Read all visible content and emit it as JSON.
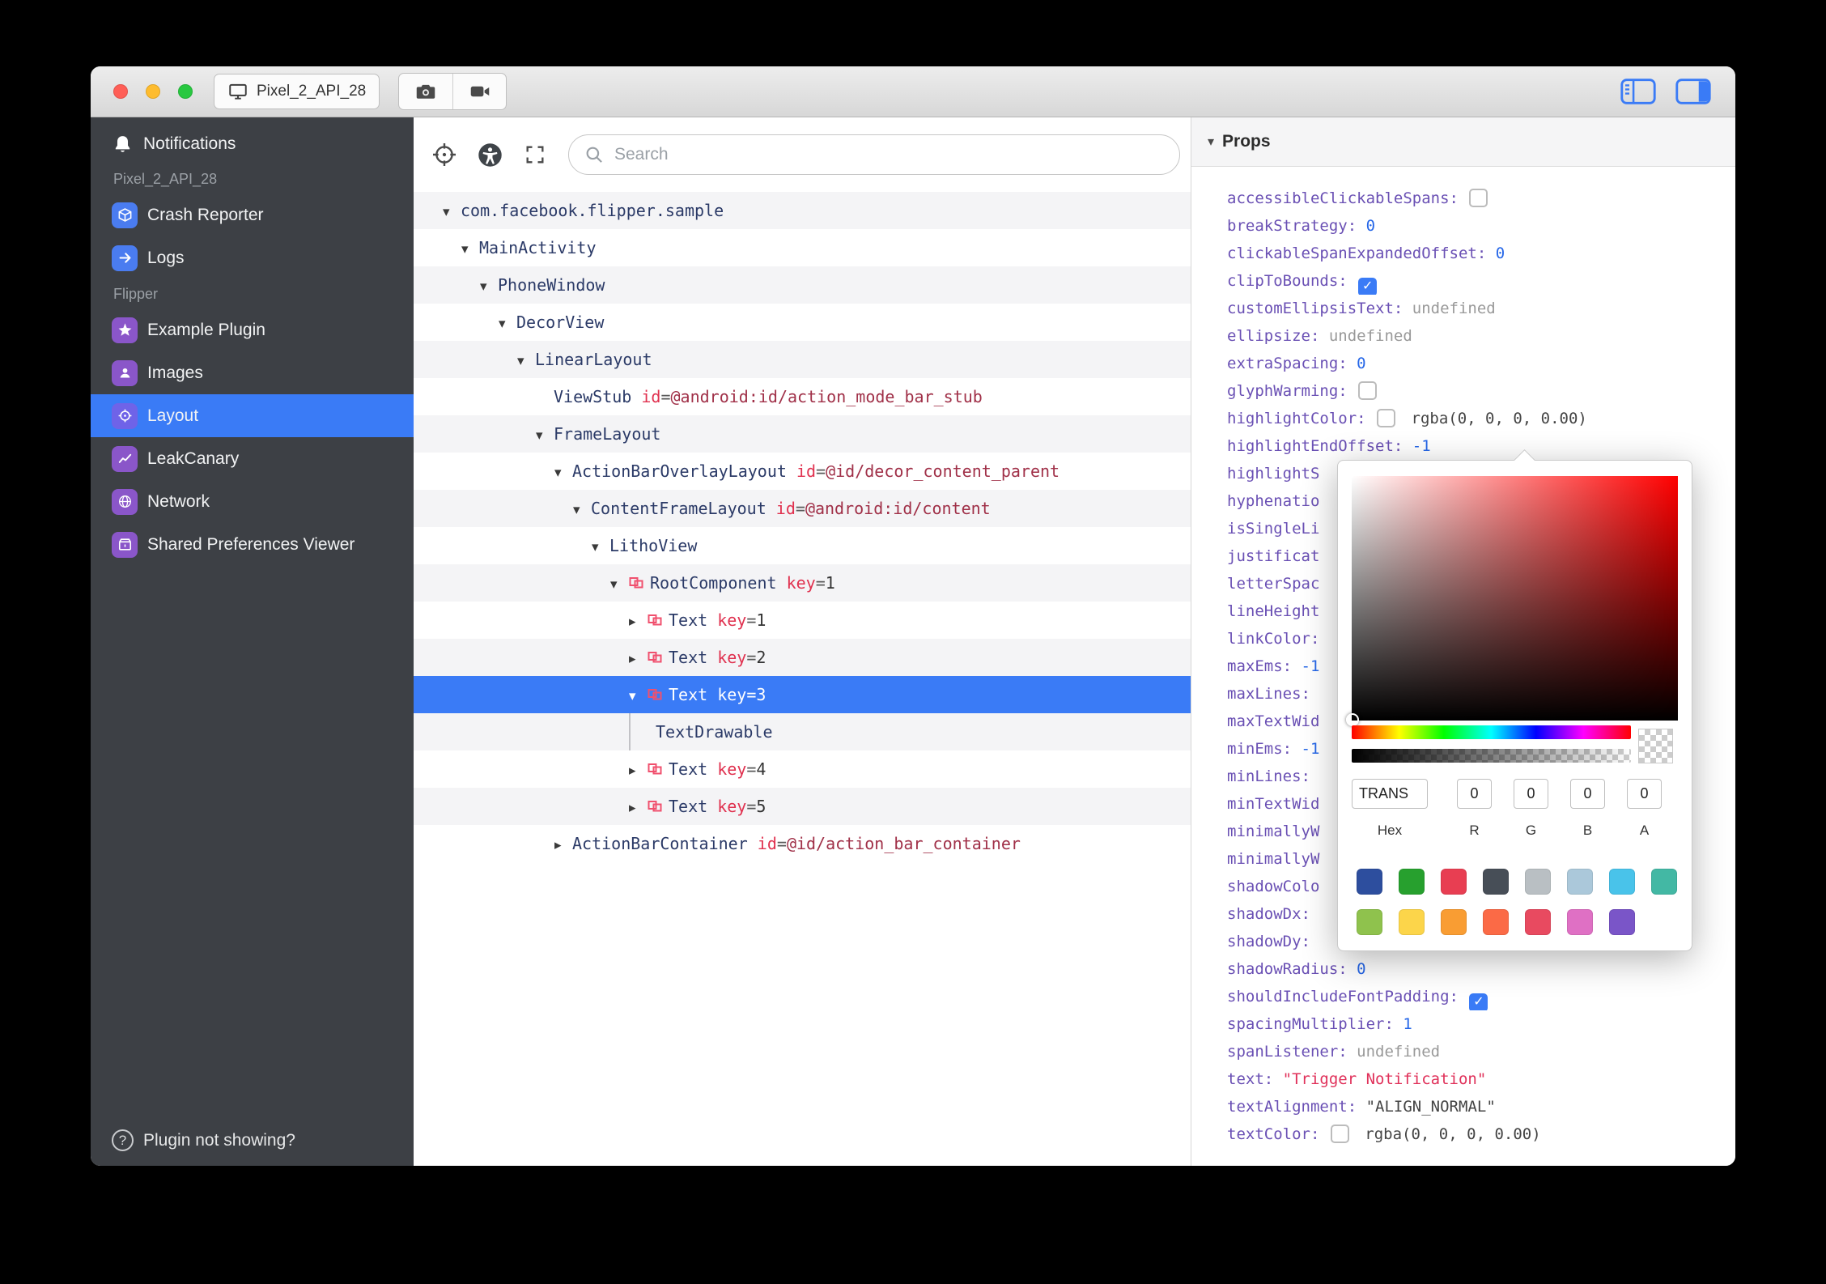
{
  "theme": {
    "selection_blue": "#3a7bf6",
    "sidebar_bg": "#3d4045",
    "prop_name": "#6a50b4",
    "prop_number": "#2667e8",
    "string_red": "#e0315a",
    "tree_name": "#2b3a67",
    "attr_red": "#e0314f",
    "litho_pink": "#f0506e"
  },
  "titlebar": {
    "device_name": "Pixel_2_API_28"
  },
  "sidebar": {
    "notifications_label": "Notifications",
    "sections": [
      {
        "label": "Pixel_2_API_28",
        "items": [
          {
            "label": "Crash Reporter",
            "icon": "crash-reporter-icon",
            "color": "#4a7cf0"
          },
          {
            "label": "Logs",
            "icon": "logs-icon",
            "color": "#4a7cf0"
          }
        ]
      },
      {
        "label": "Flipper",
        "items": [
          {
            "label": "Example Plugin",
            "icon": "example-plugin-icon",
            "color": "#8a56c9"
          },
          {
            "label": "Images",
            "icon": "images-icon",
            "color": "#8a56c9"
          },
          {
            "label": "Layout",
            "icon": "layout-icon",
            "color": "#6f63e8",
            "selected": true
          },
          {
            "label": "LeakCanary",
            "icon": "leakcanary-icon",
            "color": "#8a56c9"
          },
          {
            "label": "Network",
            "icon": "network-icon",
            "color": "#8a56c9"
          },
          {
            "label": "Shared Preferences Viewer",
            "icon": "shared-preferences-icon",
            "color": "#8a56c9"
          }
        ]
      }
    ],
    "footer": "Plugin not showing?"
  },
  "inspector": {
    "search_placeholder": "Search",
    "tree": [
      {
        "depth": 0,
        "chevron": "down",
        "name": "com.facebook.flipper.sample"
      },
      {
        "depth": 1,
        "chevron": "down",
        "name": "MainActivity"
      },
      {
        "depth": 2,
        "chevron": "down",
        "name": "PhoneWindow"
      },
      {
        "depth": 3,
        "chevron": "down",
        "name": "DecorView"
      },
      {
        "depth": 4,
        "chevron": "down",
        "name": "LinearLayout"
      },
      {
        "depth": 5,
        "chevron": "none",
        "name": "ViewStub",
        "attr": "id",
        "value": "@android:id/action_mode_bar_stub"
      },
      {
        "depth": 5,
        "chevron": "down",
        "name": "FrameLayout"
      },
      {
        "depth": 6,
        "chevron": "down",
        "name": "ActionBarOverlayLayout",
        "attr": "id",
        "value": "@id/decor_content_parent"
      },
      {
        "depth": 7,
        "chevron": "down",
        "name": "ContentFrameLayout",
        "attr": "id",
        "value": "@android:id/content"
      },
      {
        "depth": 8,
        "chevron": "down",
        "name": "LithoView"
      },
      {
        "depth": 9,
        "chevron": "down",
        "litho": true,
        "name": "RootComponent",
        "attr": "key",
        "value": "1"
      },
      {
        "depth": 10,
        "chevron": "right",
        "litho": true,
        "name": "Text",
        "attr": "key",
        "value": "1"
      },
      {
        "depth": 10,
        "chevron": "right",
        "litho": true,
        "name": "Text",
        "attr": "key",
        "value": "2"
      },
      {
        "depth": 10,
        "chevron": "down",
        "litho": true,
        "name": "Text",
        "attr": "key",
        "value": "3",
        "selected": true
      },
      {
        "depth": 11,
        "chevron": "none",
        "guide": true,
        "name": "TextDrawable"
      },
      {
        "depth": 10,
        "chevron": "right",
        "litho": true,
        "name": "Text",
        "attr": "key",
        "value": "4"
      },
      {
        "depth": 10,
        "chevron": "right",
        "litho": true,
        "name": "Text",
        "attr": "key",
        "value": "5"
      },
      {
        "depth": 6,
        "chevron": "right",
        "name": "ActionBarContainer",
        "attr": "id",
        "value": "@id/action_bar_container"
      }
    ]
  },
  "props": {
    "title": "Props",
    "rows": [
      {
        "label": "accessibleClickableSpans:",
        "type": "checkbox",
        "checked": false
      },
      {
        "label": "breakStrategy:",
        "type": "number",
        "value": "0"
      },
      {
        "label": "clickableSpanExpandedOffset:",
        "type": "number",
        "value": "0"
      },
      {
        "label": "clipToBounds:",
        "type": "checkbox",
        "checked": true
      },
      {
        "label": "customEllipsisText:",
        "type": "undefined",
        "value": "undefined"
      },
      {
        "label": "ellipsize:",
        "type": "undefined",
        "value": "undefined"
      },
      {
        "label": "extraSpacing:",
        "type": "number",
        "value": "0"
      },
      {
        "label": "glyphWarming:",
        "type": "checkbox",
        "checked": false
      },
      {
        "label": "highlightColor:",
        "type": "color",
        "checked": false,
        "value": "rgba(0, 0, 0, 0.00)"
      },
      {
        "label": "highlightEndOffset:",
        "type": "number",
        "value": "-1"
      },
      {
        "label": "highlightS",
        "type": "none"
      },
      {
        "label": "hyphenatio",
        "type": "none"
      },
      {
        "label": "isSingleLi",
        "type": "none"
      },
      {
        "label": "justificat",
        "type": "none"
      },
      {
        "label": "letterSpac",
        "type": "none"
      },
      {
        "label": "lineHeight",
        "type": "none"
      },
      {
        "label": "linkColor:",
        "type": "none"
      },
      {
        "label": "maxEms:",
        "type": "number",
        "value": "-1"
      },
      {
        "label": "maxLines:",
        "type": "none"
      },
      {
        "label": "maxTextWid",
        "type": "none"
      },
      {
        "label": "minEms:",
        "type": "number",
        "value": "-1"
      },
      {
        "label": "minLines:",
        "type": "none"
      },
      {
        "label": "minTextWid",
        "type": "none"
      },
      {
        "label": "minimallyW",
        "type": "none"
      },
      {
        "label": "minimallyW",
        "type": "none"
      },
      {
        "label": "shadowColo",
        "type": "none"
      },
      {
        "label": "shadowDx:",
        "type": "none"
      },
      {
        "label": "shadowDy:",
        "type": "none"
      },
      {
        "label": "shadowRadius:",
        "type": "number",
        "value": "0"
      },
      {
        "label": "shouldIncludeFontPadding:",
        "type": "checkbox",
        "checked": true
      },
      {
        "label": "spacingMultiplier:",
        "type": "number",
        "value": "1"
      },
      {
        "label": "spanListener:",
        "type": "undefined",
        "value": "undefined"
      },
      {
        "label": "text:",
        "type": "string",
        "value": "\"Trigger Notification\"",
        "color": "red"
      },
      {
        "label": "textAlignment:",
        "type": "string",
        "value": "\"ALIGN_NORMAL\"",
        "color": "dark"
      },
      {
        "label": "textColor:",
        "type": "color",
        "checked": false,
        "value": "rgba(0, 0, 0, 0.00)"
      }
    ]
  },
  "color_picker": {
    "hex_value": "TRANS",
    "r": "0",
    "g": "0",
    "b": "0",
    "a": "0",
    "labels": {
      "hex": "Hex",
      "r": "R",
      "g": "G",
      "b": "B",
      "a": "A"
    },
    "swatch_rows": [
      [
        "#2d4e9e",
        "#27a02e",
        "#e83e52",
        "#474e57",
        "#b9bfc3",
        "#abc8da",
        "#49c3ea",
        "#43b8a4"
      ],
      [
        "#8fc24d",
        "#fcd54a",
        "#f99d33",
        "#fb6a46",
        "#e84a60",
        "#df70c4",
        "#7a55c8"
      ]
    ]
  }
}
